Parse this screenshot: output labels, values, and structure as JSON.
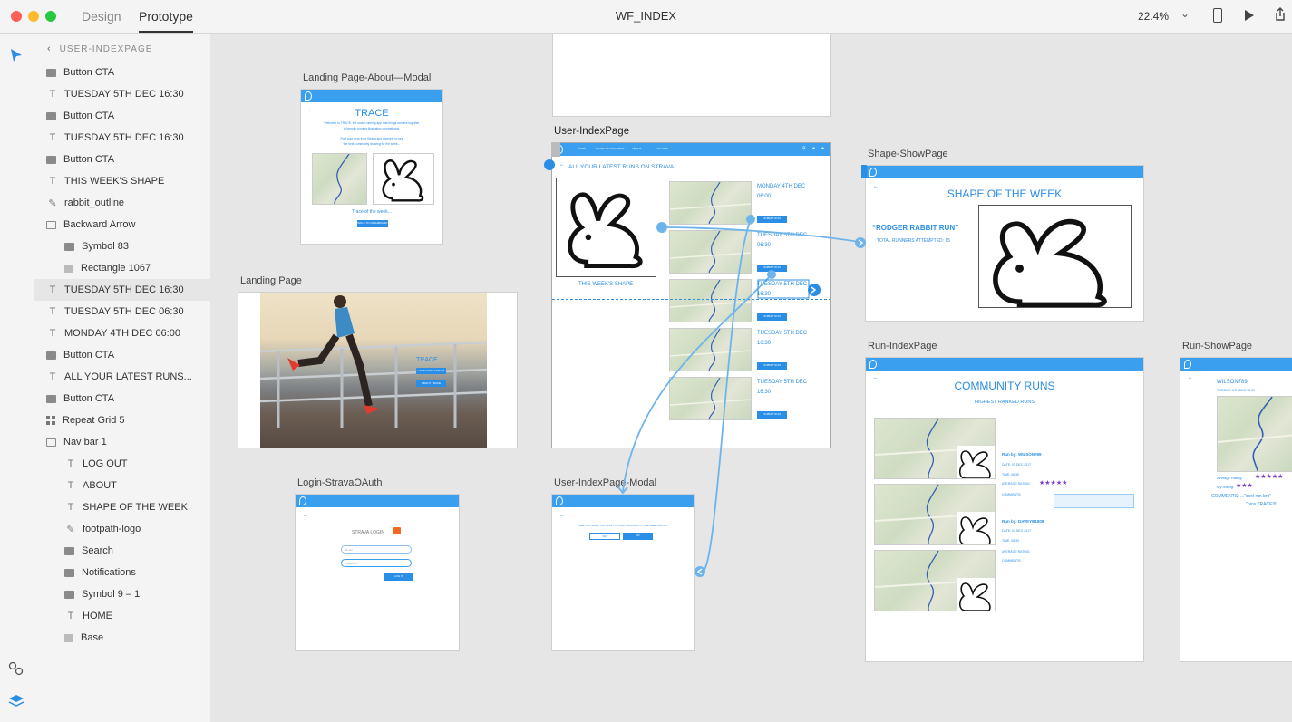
{
  "window": {
    "title": "WF_INDEX",
    "tabs": [
      "Design",
      "Prototype"
    ],
    "zoom": "22.4%"
  },
  "colors": {
    "accent": "#2a8de6",
    "nav": "#3b9ff0",
    "wire": "#6eb4ec"
  },
  "layers": {
    "header": "USER-INDEXPAGE",
    "items": [
      {
        "label": "Button CTA",
        "icon": "folder"
      },
      {
        "label": "TUESDAY 5TH DEC 16:30",
        "icon": "text"
      },
      {
        "label": "Button CTA",
        "icon": "folder"
      },
      {
        "label": "TUESDAY 5TH DEC 16:30",
        "icon": "text"
      },
      {
        "label": "Button CTA",
        "icon": "folder"
      },
      {
        "label": "THIS WEEK'S SHAPE",
        "icon": "text"
      },
      {
        "label": "rabbit_outline",
        "icon": "pen"
      },
      {
        "label": "Backward Arrow",
        "icon": "folder-open"
      },
      {
        "label": "Symbol 83",
        "icon": "folder"
      },
      {
        "label": "Rectangle 1067",
        "icon": "rect"
      },
      {
        "label": "TUESDAY 5TH DEC 16:30",
        "icon": "text"
      },
      {
        "label": "TUESDAY 5TH DEC 06:30",
        "icon": "text"
      },
      {
        "label": "MONDAY 4TH DEC 06:00",
        "icon": "text"
      },
      {
        "label": "Button CTA",
        "icon": "folder"
      },
      {
        "label": "ALL YOUR LATEST RUNS...",
        "icon": "text"
      },
      {
        "label": "Button CTA",
        "icon": "folder"
      },
      {
        "label": "Repeat Grid 5",
        "icon": "grid"
      },
      {
        "label": "Nav bar 1",
        "icon": "folder-open"
      },
      {
        "label": "LOG OUT",
        "icon": "text"
      },
      {
        "label": "ABOUT",
        "icon": "text"
      },
      {
        "label": "SHAPE OF THE WEEK",
        "icon": "text"
      },
      {
        "label": "footpath-logo",
        "icon": "pen"
      },
      {
        "label": "Search",
        "icon": "folder"
      },
      {
        "label": "Notifications",
        "icon": "folder"
      },
      {
        "label": "Symbol 9 – 1",
        "icon": "folder"
      },
      {
        "label": "HOME",
        "icon": "text"
      },
      {
        "label": "Base",
        "icon": "rect"
      }
    ]
  },
  "artboards": {
    "about_modal": {
      "label": "Landing Page-About—Modal",
      "title": "TRACE",
      "line1": "Welcome to TRACE, the social running app that brings runners together",
      "line2": "in friendly running illustration competitions.",
      "line3": "Post your runs from Strava and compete to see",
      "line4": "the best community drawing for the week...",
      "caption": "Trace of the week...",
      "button": "BACK TO DASHBOARD"
    },
    "landing": {
      "label": "Landing Page",
      "title": "TRACE",
      "btn1": "LOGIN WITH STRAVA",
      "btn2": "ABOUT TRACE"
    },
    "login": {
      "label": "Login-StravaOAuth",
      "title": "STRAVA LOGIN",
      "email": "Email",
      "password": "Password",
      "button": "LOG IN"
    },
    "user_index": {
      "label": "User-IndexPage",
      "heading": "ALL YOUR LATEST RUNS ON STRAVA",
      "shape_caption": "THIS WEEK'S SHAPE",
      "nav": [
        "HOME",
        "SHAPE OF THE WEEK",
        "ABOUT",
        "LOG OUT"
      ],
      "runs": [
        {
          "line1": "MONDAY 4TH DEC",
          "line2": "06:00",
          "button": "SUBMIT RUN"
        },
        {
          "line1": "TUESDAY 5TH DEC",
          "line2": "06:30",
          "button": "SUBMIT RUN"
        },
        {
          "line1": "TUESDAY 5TH DEC",
          "line2": "16:30",
          "button": "SUBMIT RUN"
        },
        {
          "line1": "TUESDAY 5TH DEC",
          "line2": "16:30",
          "button": "SUBMIT RUN"
        },
        {
          "line1": "TUESDAY 5TH DEC",
          "line2": "16:30",
          "button": "SUBMIT RUN"
        }
      ]
    },
    "index_modal": {
      "label": "User-IndexPage-Modal",
      "question": "ARE YOU SURE YOU WANT TO ADD THIS RUN TO THE WEEK RUNS?",
      "yes": "YES",
      "no": "NO"
    },
    "shape_show": {
      "label": "Shape-ShowPage",
      "title": "SHAPE OF THE WEEK",
      "name": "“RODGER RABBIT RUN”",
      "attempted": "TOTAL RUNNERS ATTEMPTED: 15"
    },
    "run_index": {
      "label": "Run-IndexPage",
      "title": "COMMUNITY RUNS",
      "subtitle": "HIGHEST RANKED RUNS",
      "run1": {
        "by": "Run by: WILSON789",
        "date": "DATE: 01 DEC 2017",
        "time": "TIME: 06:30",
        "rating": "AVERAGE RATING:",
        "comments": "COMMENTS:"
      },
      "run2": {
        "by": "Run by: DAVEYB1809",
        "date": "DATE: 02 DEC 2017",
        "time": "TIME: 06:30",
        "rating": "AVERAGE RATING",
        "comments": "COMMENTS:"
      },
      "stars": "★★★★★"
    },
    "run_show": {
      "label": "Run-ShowPage",
      "user": "WILSON789",
      "date": "TUESDAY 5TH DEC 18:00",
      "avg": "Average Rating:",
      "avg_stars": "★★★★★",
      "my": "My Rating:",
      "my_stars": "★★★",
      "comments": "COMMENTS:  ...\"cool run bro\"",
      "comment2": "...\"nice TRACE!!!\""
    }
  }
}
